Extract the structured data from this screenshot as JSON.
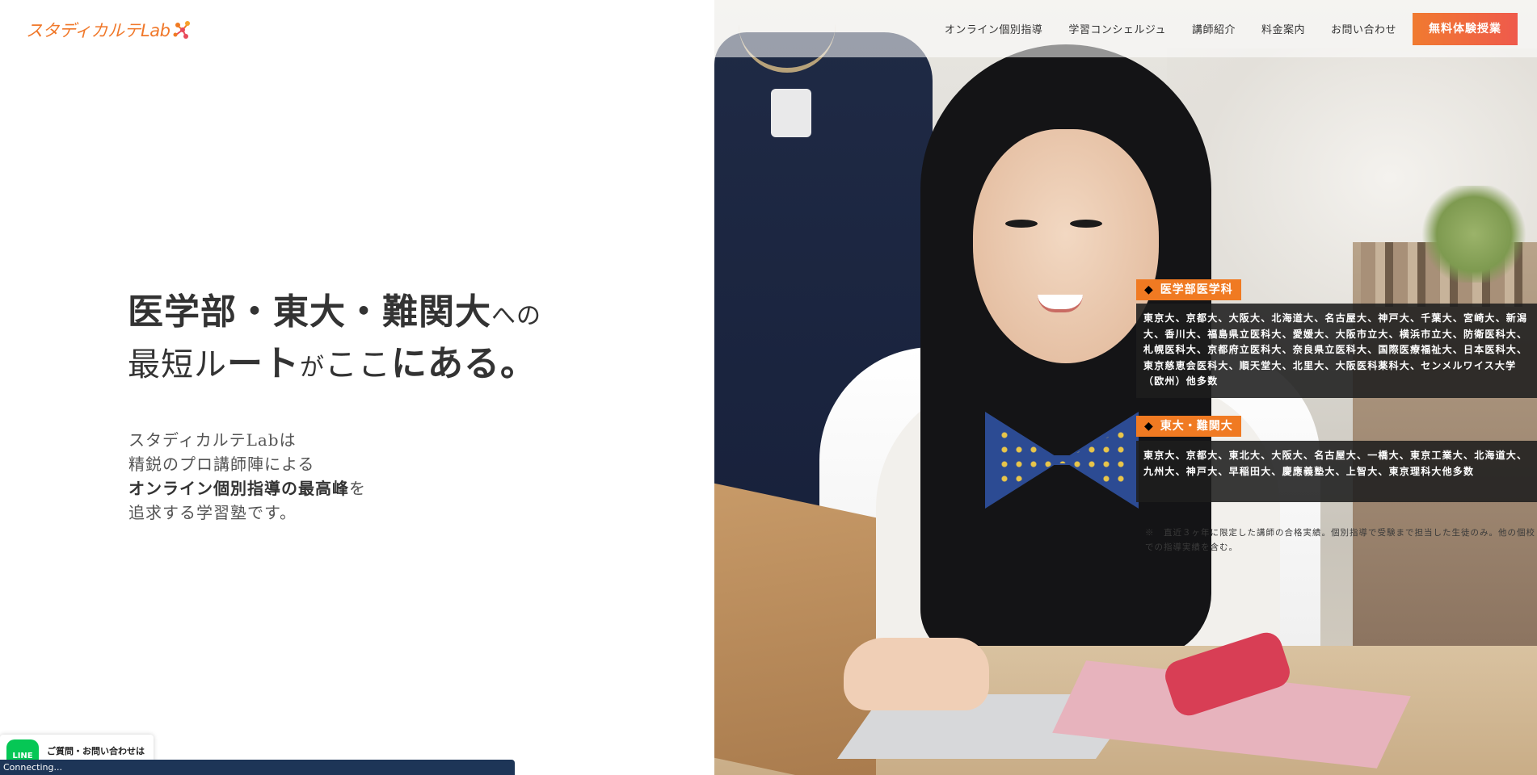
{
  "brand": {
    "logo_text": "スタディカルテLab",
    "accent": "#f07a22"
  },
  "nav": {
    "links": [
      "オンライン個別指導",
      "学習コンシェルジュ",
      "講師紹介",
      "料金案内",
      "お問い合わせ"
    ],
    "cta_label": "無料体験授業"
  },
  "hero": {
    "line1_a": "医学部・東大・難関大",
    "line1_b": "への",
    "line2_a": "最短ル",
    "line2_b": "ート",
    "line2_c": "が",
    "line2_d": "ここ",
    "line2_e": "にある。",
    "intro": [
      "スタディカルテLabは",
      "精鋭のプロ講師陣による",
      "オンライン個別指導の最高峰",
      "を",
      "追求する学習塾です。"
    ]
  },
  "results": [
    {
      "tag": "医学部医学科",
      "text": "東京大、京都大、大阪大、北海道大、名古屋大、神戸大、千葉大、宮崎大、新潟大、香川大、福島県立医科大、愛媛大、大阪市立大、横浜市立大、防衛医科大、札幌医科大、京都府立医科大、奈良県立医科大、国際医療福祉大、日本医科大、東京慈恵会医科大、順天堂大、北里大、大阪医科薬科大、センメルワイス大学（欧州）他多数"
    },
    {
      "tag": "東大・難関大",
      "text": "東京大、京都大、東北大、大阪大、名古屋大、一橋大、東京工業大、北海道大、九州大、神戸大、早稲田大、慶應義塾大、上智大、東京理科大他多数"
    }
  ],
  "note": "※　直近３ヶ年に限定した講師の合格実績。個別指導で受験まで担当した生徒のみ。他の個校での指導実績を含む。",
  "line_widget": {
    "icon_label": "LINE",
    "text": "ご質問・お問い合わせは"
  },
  "status": "Connecting..."
}
